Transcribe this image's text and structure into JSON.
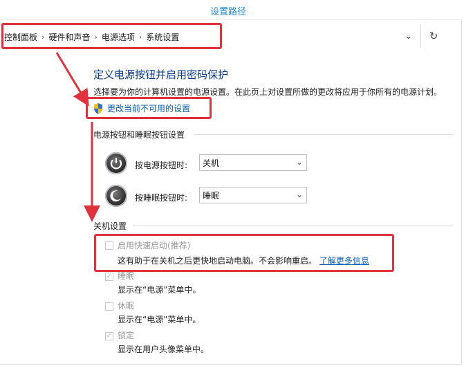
{
  "caption": "设置路径",
  "breadcrumb": [
    "控制面板",
    "硬件和声音",
    "电源选项",
    "系统设置"
  ],
  "nav": {
    "dropdown_icon": "chevron-down-icon",
    "refresh_icon": "refresh-icon"
  },
  "page": {
    "title": "定义电源按钮并启用密码保护",
    "description": "选择要为你的计算机设置的电源设置。在此页上对设置所做的更改将应用于你所有的电源计划。",
    "change_link": "更改当前不可用的设置"
  },
  "buttons_section": {
    "heading": "电源按钮和睡眠按钮设置",
    "power_label": "按电源按钮时:",
    "power_value": "关机",
    "sleep_label": "按睡眠按钮时:",
    "sleep_value": "睡眠"
  },
  "shutdown_section": {
    "heading": "关机设置",
    "options": [
      {
        "title": "启用快速启动(推荐)",
        "desc": "这有助于在关机之后更快地启动电脑。不会影响重启。",
        "link": "了解更多信息",
        "checked": false
      },
      {
        "title": "睡眠",
        "desc": "显示在“电源”菜单中。",
        "checked": true
      },
      {
        "title": "休眠",
        "desc": "显示在“电源”菜单中。",
        "checked": false
      },
      {
        "title": "锁定",
        "desc": "显示在用户头像菜单中。",
        "checked": true
      }
    ]
  },
  "colors": {
    "highlight": "#e0323d",
    "link": "#0a5fb5",
    "title": "#0a3b8c",
    "caption": "#1e88d4"
  }
}
